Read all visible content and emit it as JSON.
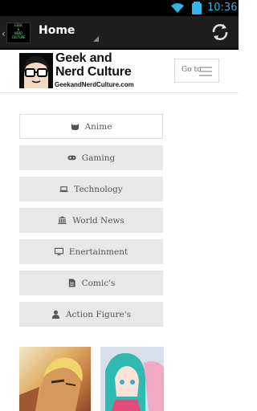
{
  "status_bar": {
    "time": "10:36",
    "icons": [
      "wifi-icon",
      "battery-icon"
    ]
  },
  "action_bar": {
    "app_logo_lines": [
      "GEEK",
      "&",
      "NERD",
      "CULTURE"
    ],
    "title": "Home",
    "icons": [
      "up-caret-icon",
      "refresh-icon"
    ]
  },
  "site_header": {
    "logo_line1": "Geek and",
    "logo_line2": "Nerd Culture",
    "logo_url": "GeekandNerdCulture.com",
    "goto_label": "Go to"
  },
  "menu": {
    "items": [
      {
        "label": "Anime",
        "icon": "github-cat-icon"
      },
      {
        "label": "Gaming",
        "icon": "gamepad-icon"
      },
      {
        "label": "Technology",
        "icon": "laptop-icon"
      },
      {
        "label": "World News",
        "icon": "bank-icon"
      },
      {
        "label": "Enertainment",
        "icon": "monitor-icon"
      },
      {
        "label": "Comic's",
        "icon": "document-icon"
      },
      {
        "label": "Action Figure's",
        "icon": "user-icon"
      }
    ]
  },
  "colors": {
    "accent": "#33b5e5",
    "action_bar": "#1d1d1d",
    "menu_bg": "#e8e8e8"
  }
}
